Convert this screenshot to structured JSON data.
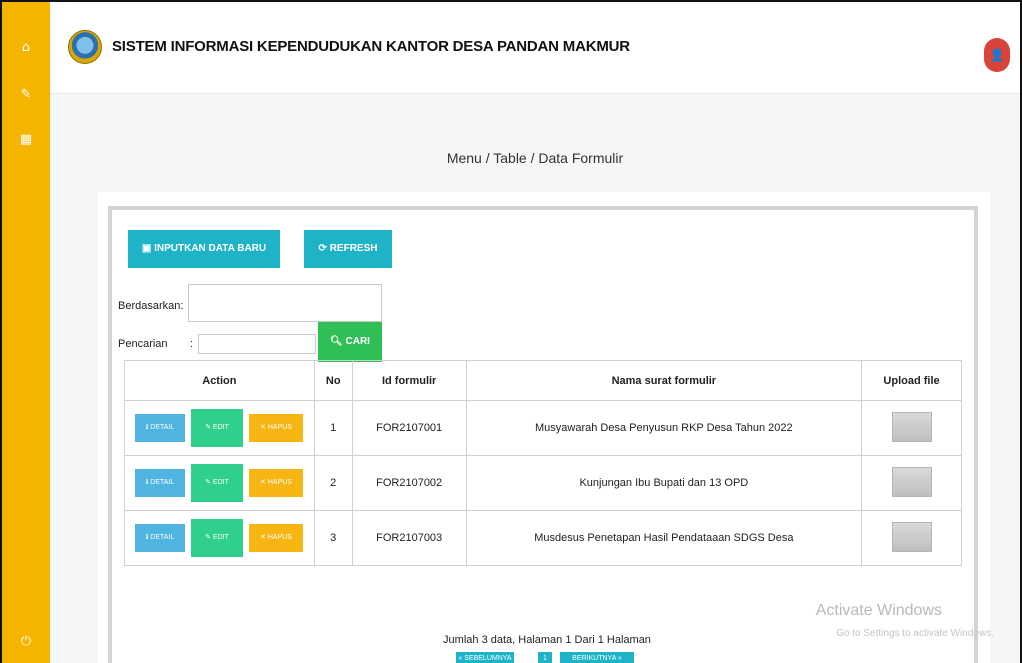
{
  "app": {
    "title": "SISTEM INFORMASI KEPENDUDUKAN KANTOR DESA PANDAN MAKMUR"
  },
  "sidebar": {
    "icons": [
      "home-icon",
      "edit-icon",
      "calendar-icon",
      "power-icon"
    ]
  },
  "breadcrumb": "Menu / Table / Data Formulir",
  "toolbar": {
    "new_label": "INPUTKAN DATA BARU",
    "refresh_label": "REFRESH"
  },
  "search": {
    "berdasarkan_label": "Berdasarkan:",
    "pencarian_label": "Pencarian",
    "colon": ":",
    "cari_label": "CARI"
  },
  "table": {
    "headers": [
      "Action",
      "No",
      "Id formulir",
      "Nama surat formulir",
      "Upload file"
    ],
    "action_labels": {
      "detail": "DETAIL",
      "edit": "EDIT",
      "hapus": "HAPUS"
    },
    "rows": [
      {
        "no": "1",
        "id": "FOR2107001",
        "nama": "Musyawarah Desa Penyusun RKP Desa Tahun 2022"
      },
      {
        "no": "2",
        "id": "FOR2107002",
        "nama": "Kunjungan Ibu Bupati dan 13 OPD"
      },
      {
        "no": "3",
        "id": "FOR2107003",
        "nama": "Musdesus Penetapan Hasil Pendataaan SDGS Desa"
      }
    ]
  },
  "pagination": {
    "summary": "Jumlah 3 data, Halaman 1 Dari 1 Halaman",
    "prev": "« SEBELUMNYA",
    "current": "1",
    "next": "BERIKUTNYA »"
  },
  "watermark": {
    "title": "Activate Windows",
    "subtitle": "Go to Settings to activate Windows."
  },
  "colors": {
    "sidebar": "#f5b400",
    "primary": "#1fb3c8",
    "success": "#2fbf56",
    "warning": "#f6b512",
    "danger_avatar": "#d9443a"
  }
}
